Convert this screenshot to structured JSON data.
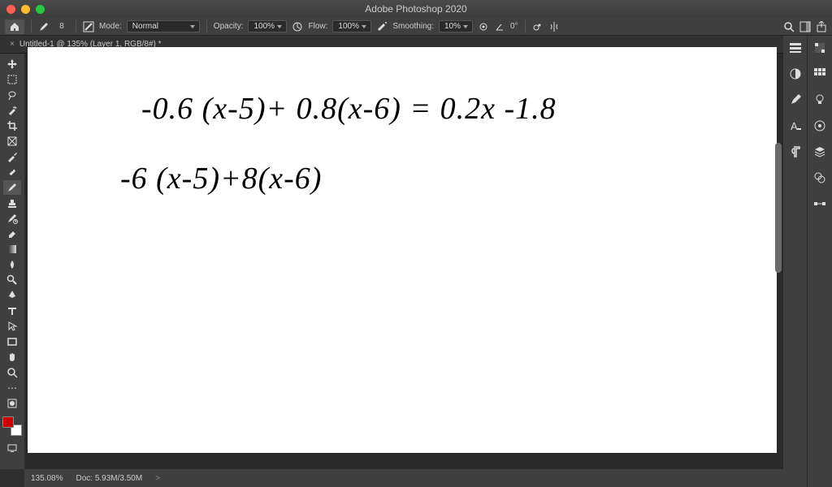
{
  "app": {
    "title": "Adobe Photoshop 2020"
  },
  "doc": {
    "tab": "Untitled-1 @ 135% (Layer 1, RGB/8#) *"
  },
  "options": {
    "brush_size": "8",
    "mode_label": "Mode:",
    "mode_value": "Normal",
    "opacity_label": "Opacity:",
    "opacity_value": "100%",
    "flow_label": "Flow:",
    "flow_value": "100%",
    "smoothing_label": "Smoothing:",
    "smoothing_value": "10%",
    "angle_value": "0°"
  },
  "canvas_text": {
    "line1": "-0.6 (x-5)+ 0.8(x-6) = 0.2x -1.8",
    "line2": "-6 (x-5)+8(x-6)"
  },
  "status": {
    "zoom": "135.08%",
    "doc_info": "Doc: 5.93M/3.50M",
    "arrow": ">"
  },
  "tools": [
    "move",
    "marquee",
    "lasso",
    "wand",
    "crop",
    "frame",
    "eyedrop",
    "heal",
    "brush",
    "stamp",
    "history",
    "eraser",
    "gradient",
    "blur",
    "dodge",
    "pen",
    "type",
    "path",
    "rect",
    "hand",
    "zoom",
    "more"
  ],
  "right_col1": [
    "props",
    "adjust",
    "brushset",
    "char",
    "paragraph"
  ],
  "right_col2": [
    "color",
    "swatches",
    "styles",
    "layers",
    "channels",
    "paths"
  ]
}
